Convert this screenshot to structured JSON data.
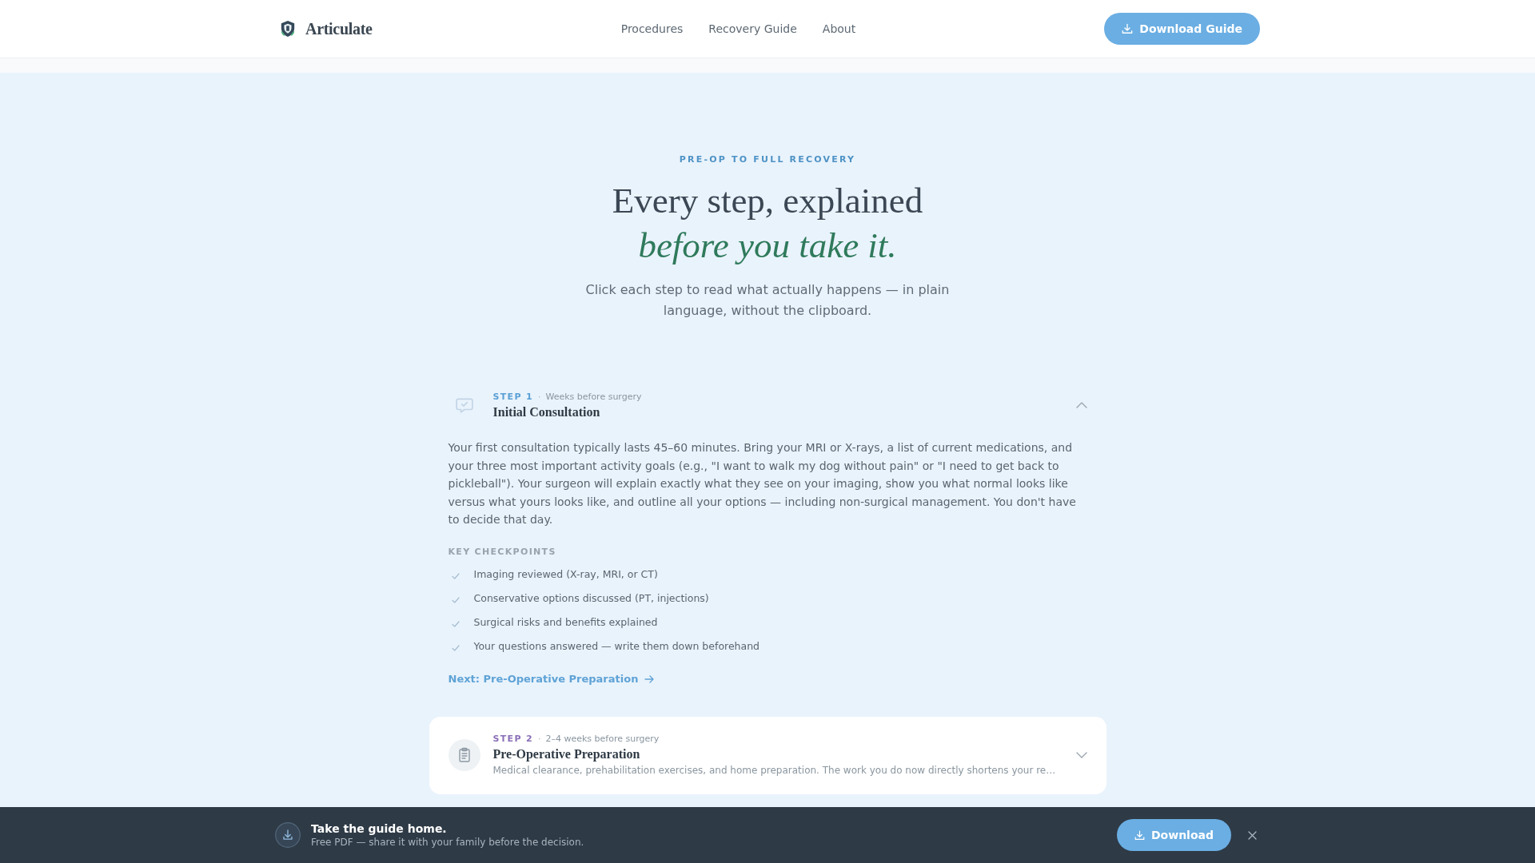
{
  "header": {
    "brand": "Articulate",
    "nav": [
      "Procedures",
      "Recovery Guide",
      "About"
    ],
    "cta": "Download Guide"
  },
  "hero": {
    "eyebrow": "PRE-OP TO FULL RECOVERY",
    "title": "Every step, explained *before you take it.*",
    "subtitle": "Click each step to read what actually happens — in plain language, without the clipboard."
  },
  "steps": [
    {
      "label": "STEP 1",
      "dot": "·",
      "timing": "Weeks before surgery",
      "title": "Initial Consultation",
      "color": "#5a9fd4",
      "expanded": true,
      "body": "Your first consultation typically lasts 45–60 minutes. Bring your MRI or X-rays, a list of current medications, and your three most important activity goals (e.g., \"I want to walk my dog without pain\" or \"I need to get back to pickleball\"). Your surgeon will explain exactly what they see on your imaging, show you what normal looks like versus what yours looks like, and outline all your options — including non-surgical management. You don't have to decide that day.",
      "checkpoints_title": "KEY CHECKPOINTS",
      "checkpoints": [
        "Imaging reviewed (X-ray, MRI, or CT)",
        "Conservative options discussed (PT, injections)",
        "Surgical risks and benefits explained",
        "Your questions answered — write them down beforehand"
      ],
      "next_link": "Next: Pre-Operative Preparation"
    },
    {
      "label": "STEP 2",
      "dot": "·",
      "timing": "2–4 weeks before surgery",
      "title": "Pre-Operative Preparation",
      "color": "#8a6fb8",
      "expanded": false,
      "summary": "Medical clearance, prehabilitation exercises, and home preparation. The work you do now directly shortens your re…"
    }
  ],
  "download_bar": {
    "title": "Take the guide home.",
    "subtitle": "Free PDF — share it with your family before the decision.",
    "button": "Download"
  }
}
